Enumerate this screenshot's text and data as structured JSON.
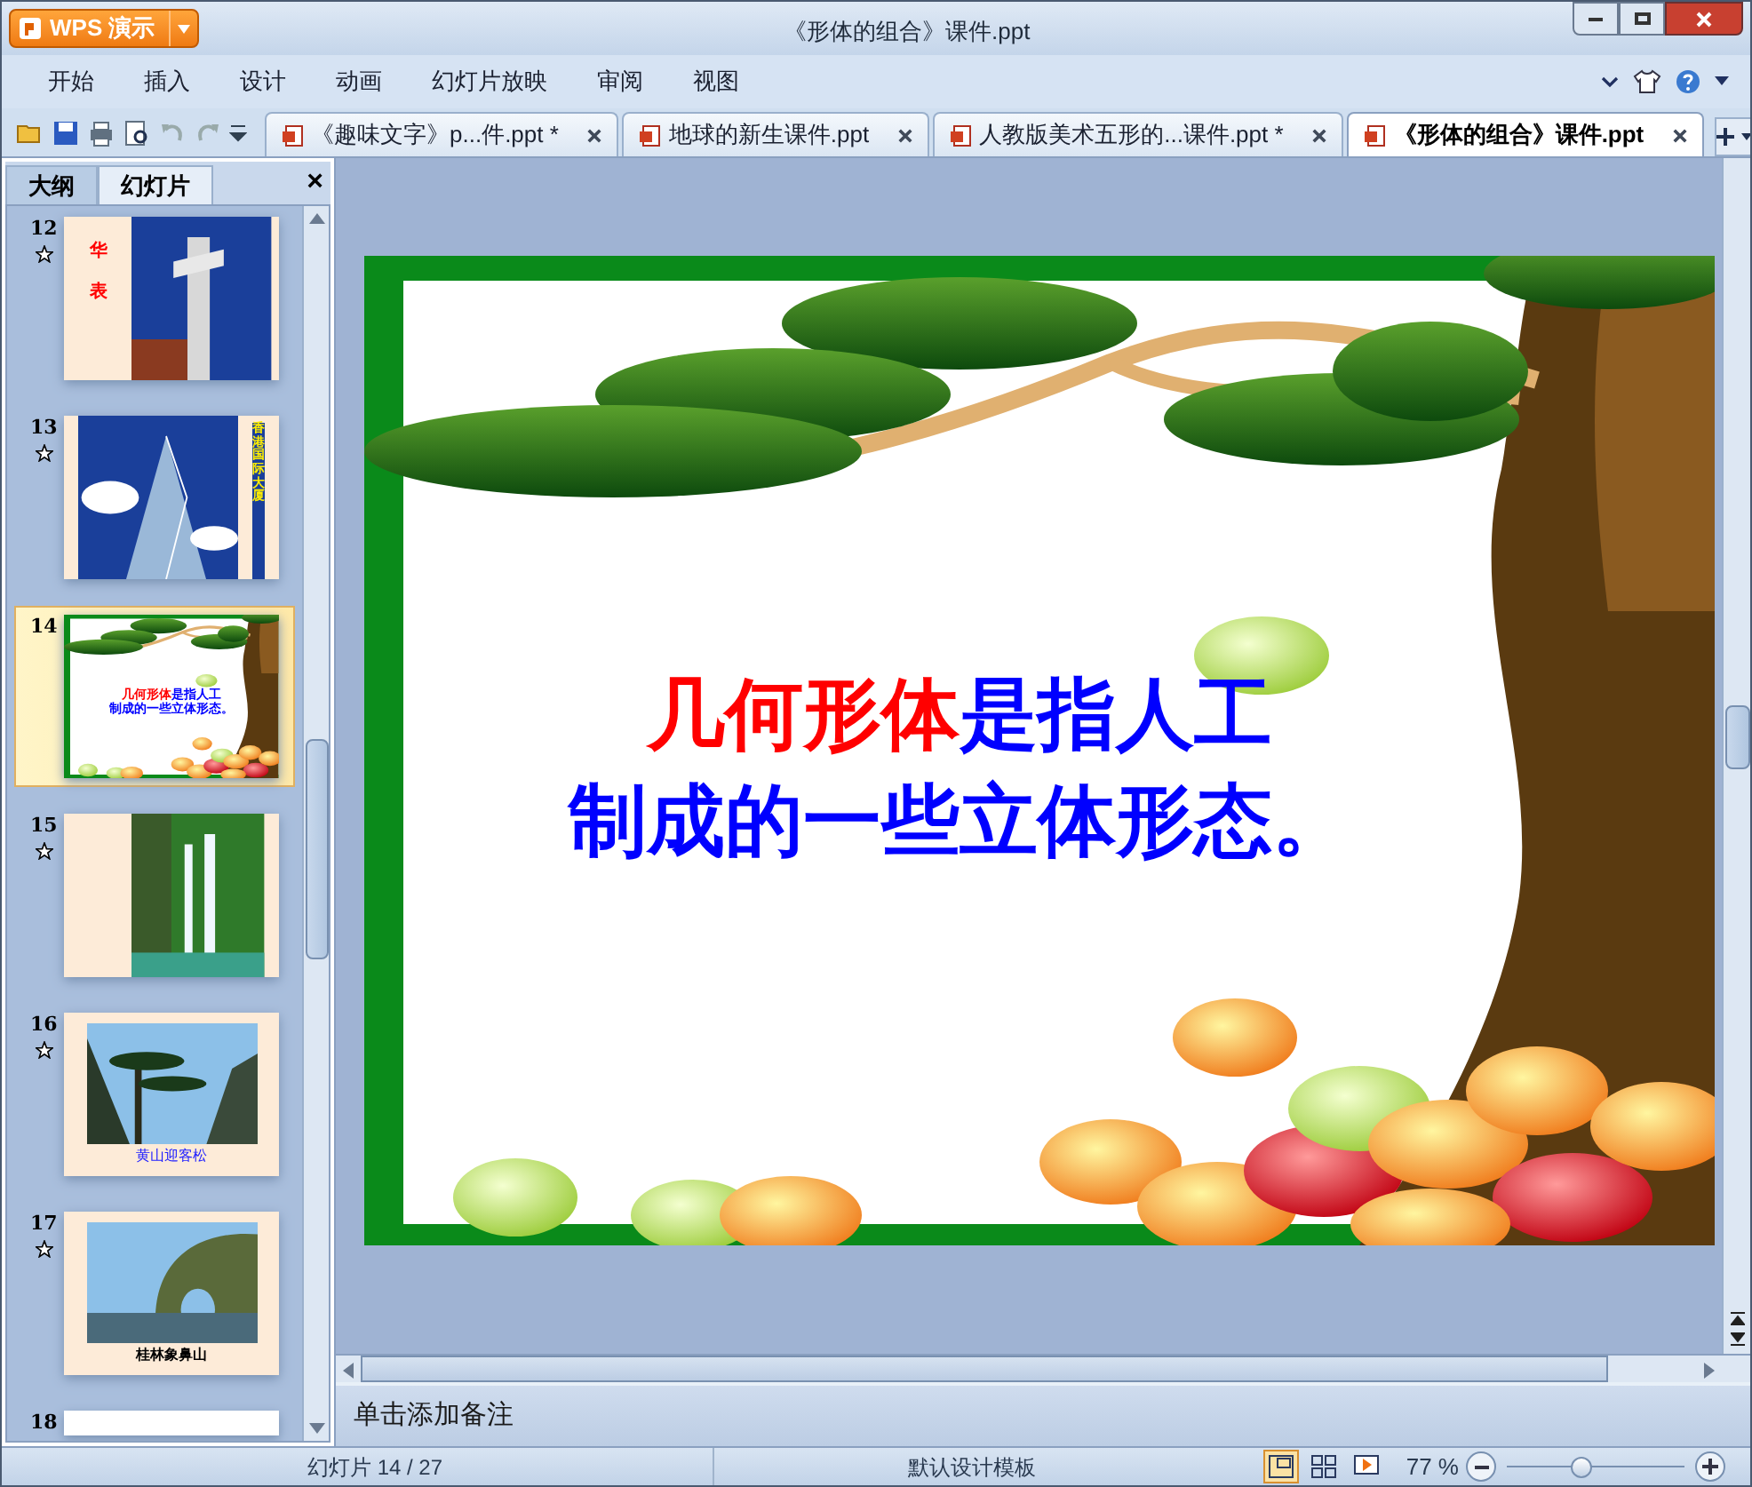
{
  "window": {
    "app_button": "WPS 演示",
    "title": "《形体的组合》课件.ppt"
  },
  "menu": [
    {
      "label": "开始"
    },
    {
      "label": "插入"
    },
    {
      "label": "设计"
    },
    {
      "label": "动画"
    },
    {
      "label": "幻灯片放映"
    },
    {
      "label": "审阅"
    },
    {
      "label": "视图"
    }
  ],
  "doc_tabs": [
    {
      "label": "《趣味文字》p...件.ppt *",
      "selected": false
    },
    {
      "label": "地球的新生课件.ppt",
      "selected": false
    },
    {
      "label": "人教版美术五形的...课件.ppt *",
      "selected": false
    },
    {
      "label": "《形体的组合》课件.ppt",
      "selected": true
    }
  ],
  "panel": {
    "tabs": [
      {
        "label": "大纲",
        "selected": false
      },
      {
        "label": "幻灯片",
        "selected": true
      }
    ],
    "close": "×"
  },
  "thumbnails": [
    {
      "number": "12",
      "kind": "pillar",
      "animated": true,
      "selected": false,
      "texts": [
        "华",
        "表"
      ]
    },
    {
      "number": "13",
      "kind": "building",
      "animated": true,
      "selected": false,
      "texts": [
        "香港国际大厦"
      ]
    },
    {
      "number": "14",
      "kind": "title",
      "animated": false,
      "selected": true,
      "lines": [
        [
          {
            "text": "几何形体",
            "color": "#ff0000"
          },
          {
            "text": "是指人工",
            "color": "#0000ff"
          }
        ],
        [
          {
            "text": "制成的一些立体形态。",
            "color": "#0000ff"
          }
        ]
      ]
    },
    {
      "number": "15",
      "kind": "waterfall",
      "animated": true,
      "selected": false
    },
    {
      "number": "16",
      "kind": "pine",
      "animated": true,
      "selected": false,
      "texts": [
        "黄山迎客松"
      ]
    },
    {
      "number": "17",
      "kind": "hill",
      "animated": true,
      "selected": false,
      "texts": [
        "桂林象鼻山"
      ]
    },
    {
      "number": "18",
      "kind": "blank",
      "animated": false,
      "selected": false
    }
  ],
  "slide": {
    "lines": [
      [
        {
          "text": "几何形体",
          "color": "#ff0000"
        },
        {
          "text": "是指人工",
          "color": "#0000ff"
        }
      ],
      [
        {
          "text": "制成的一些立体形态。",
          "color": "#0000ff"
        }
      ]
    ]
  },
  "notes": {
    "placeholder": "单击添加备注"
  },
  "status_bar": {
    "slide_count": "幻灯片 14 / 27",
    "template": "默认设计模板",
    "views": [
      {
        "kind": "normal",
        "selected": true
      },
      {
        "kind": "sorter",
        "selected": false
      },
      {
        "kind": "show",
        "selected": false
      }
    ],
    "zoom": "77 %",
    "zoom_slider": {
      "level": 0.42
    }
  }
}
